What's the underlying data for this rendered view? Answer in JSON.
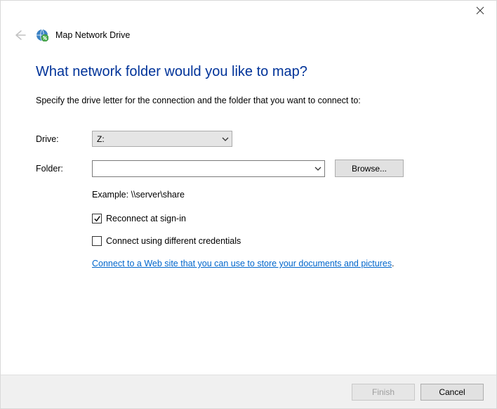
{
  "window": {
    "title": "Map Network Drive"
  },
  "content": {
    "heading": "What network folder would you like to map?",
    "subtext": "Specify the drive letter for the connection and the folder that you want to connect to:",
    "drive_label": "Drive:",
    "drive_value": "Z:",
    "folder_label": "Folder:",
    "folder_value": "",
    "browse_label": "Browse...",
    "example_text": "Example: \\\\server\\share",
    "reconnect_label": "Reconnect at sign-in",
    "reconnect_checked": true,
    "diffcred_label": "Connect using different credentials",
    "diffcred_checked": false,
    "link_text": "Connect to a Web site that you can use to store your documents and pictures"
  },
  "footer": {
    "finish_label": "Finish",
    "cancel_label": "Cancel"
  }
}
